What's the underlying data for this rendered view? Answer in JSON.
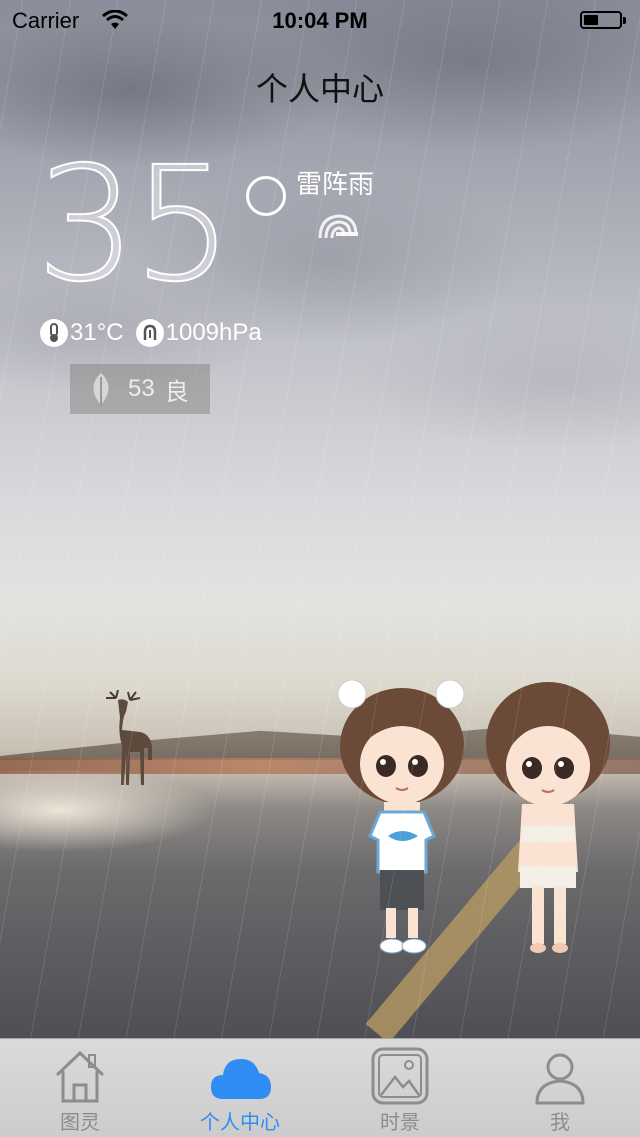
{
  "status_bar": {
    "carrier": "Carrier",
    "time": "10:04 PM",
    "battery_level": 0.4
  },
  "header": {
    "title": "个人中心"
  },
  "weather": {
    "temperature": "35",
    "condition": "雷阵雨",
    "feels_like": "31°C",
    "pressure": "1009hPa",
    "aqi_value": "53",
    "aqi_level": "良"
  },
  "tab_bar": {
    "tabs": [
      {
        "label": "图灵",
        "icon": "home-icon",
        "active": false
      },
      {
        "label": "个人中心",
        "icon": "cloud-icon",
        "active": true
      },
      {
        "label": "时景",
        "icon": "picture-icon",
        "active": false
      },
      {
        "label": "我",
        "icon": "user-icon",
        "active": false
      }
    ]
  },
  "colors": {
    "active_tab": "#2f8cf2",
    "inactive_tab": "#8d8d8d"
  }
}
